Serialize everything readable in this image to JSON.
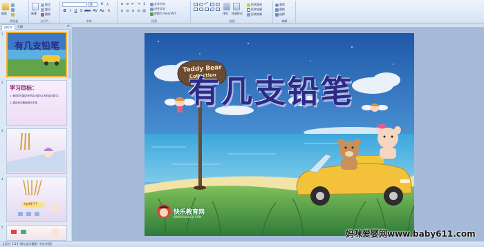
{
  "ribbon": {
    "groups": [
      "剪贴板",
      "幻灯片",
      "字体",
      "段落",
      "绘图",
      "编辑"
    ],
    "paste_label": "粘贴",
    "new_slide_label": "新建",
    "layout_label": "版式",
    "reset_label": "重设",
    "delete_label": "删除",
    "font_name": "",
    "font_size": "36",
    "text_direction_label": "文字方向",
    "align_text_label": "对齐文本",
    "smartart_label": "转换为 SmartArt",
    "arrange_label": "排列",
    "quick_styles_label": "快速样式",
    "shape_fill_label": "形状填充",
    "shape_outline_label": "形状轮廓",
    "shape_effects_label": "形状效果",
    "find_label": "查找",
    "replace_label": "替换",
    "select_label": "选择"
  },
  "pane": {
    "tabs": [
      "幻灯片",
      "大纲"
    ],
    "thumbs": [
      {
        "num": "1",
        "title": "有几支铅笔"
      },
      {
        "num": "2",
        "title": "学习目标：",
        "lines": [
          "1. 使同学们能初步学会计算5以内的加法算式；",
          "2. 能初步正确地进行计算。"
        ]
      },
      {
        "num": "3"
      },
      {
        "num": "4",
        "caption": "3加4等于7"
      },
      {
        "num": "5"
      }
    ]
  },
  "slide": {
    "title": "有几支铅笔",
    "sign_line1": "Teddy Bear",
    "sign_line2": "Collection",
    "logo_text": "快乐教育网",
    "logo_sub": "WWW.KUAILEJY.COM"
  },
  "status": {
    "text": "幻灯片 1/13   \"默认设计模板\"   中文(中国)"
  },
  "watermark": "妈咪爱婴网www.baby611.com",
  "colors": {
    "ribbon_bg": "#dbe6f5",
    "title_text": "#2d2a86",
    "selected_thumb_border": "#f0b43c"
  }
}
